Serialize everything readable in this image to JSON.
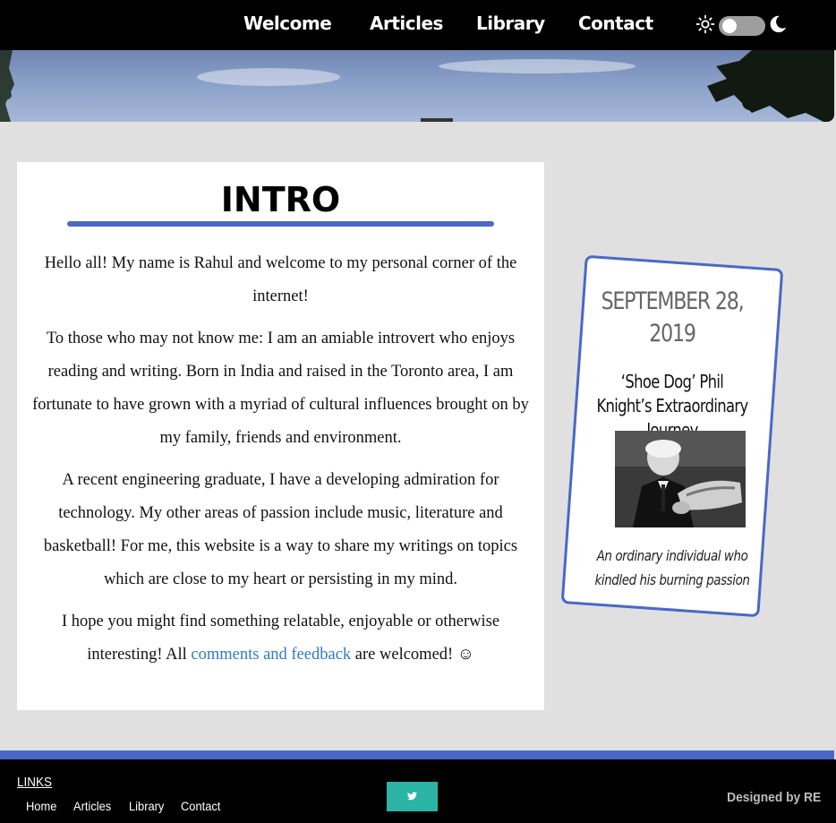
{
  "nav": {
    "items": [
      {
        "label": "Welcome"
      },
      {
        "label": "Articles"
      },
      {
        "label": "Library"
      },
      {
        "label": "Contact"
      }
    ],
    "theme_toggle": {
      "left_icon": "sun-icon",
      "right_icon": "moon-icon",
      "state": "light"
    }
  },
  "intro": {
    "title": "INTRO",
    "paragraphs": [
      "Hello all! My name is Rahul and welcome to my personal corner of the internet!",
      "To those who may not know me: I am an amiable introvert who enjoys reading and writing. Born in India and raised in the Toronto area, I am fortunate to have grown with a myriad of cultural influences brought on by my family, friends and environment.",
      "A recent engineering graduate, I have a developing admiration for technology. My other areas of passion include music, literature and basketball! For me, this website is a way to share my writings on topics which are close to my heart or persisting in my mind."
    ],
    "last_paragraph": {
      "before": "I hope you might find something relatable, enjoyable or otherwise interesting! All ",
      "link": "comments and feedback",
      "after": " are welcomed! ",
      "emoji": "☺"
    }
  },
  "card": {
    "date": "SEPTEMBER 28, 2019",
    "title": "‘Shoe Dog’ Phil Knight’s Extraordinary Journey",
    "subtitle": "An ordinary individual who kindled his burning passion"
  },
  "footer": {
    "links_heading": "LINKS",
    "links": [
      {
        "label": "Home"
      },
      {
        "label": "Articles"
      },
      {
        "label": "Library"
      },
      {
        "label": "Contact"
      }
    ],
    "social_icon": "twitter-icon",
    "designed_by": "Designed by RE"
  },
  "colors": {
    "accent": "#4a68c8",
    "link": "#2f7cc0",
    "social": "#2bb4a6",
    "background": "#e0e0e0"
  }
}
